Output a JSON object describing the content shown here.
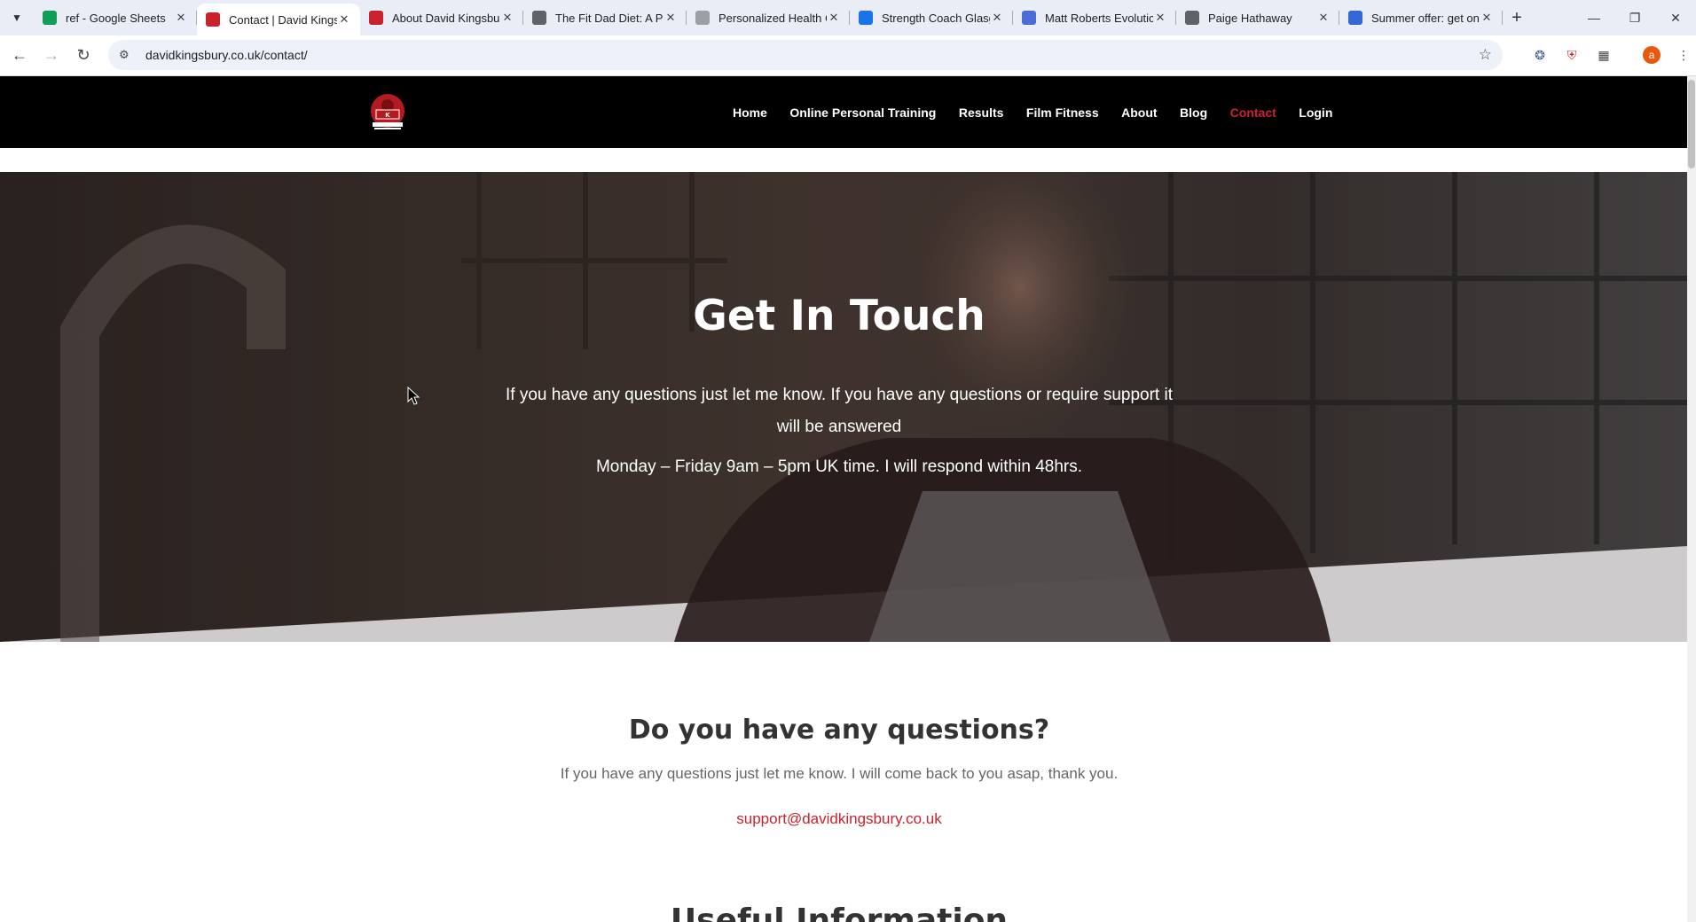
{
  "browser": {
    "tabs": [
      {
        "title": "ref - Google Sheets",
        "icon": "sheets-icon",
        "color": "#0f9d58",
        "active": false
      },
      {
        "title": "Contact | David Kings",
        "icon": "kingsbury-icon",
        "color": "#c8232c",
        "active": true
      },
      {
        "title": "About David Kingsbu",
        "icon": "kingsbury-icon",
        "color": "#c8232c",
        "active": false
      },
      {
        "title": "The Fit Dad Diet: A Pr",
        "icon": "globe-icon",
        "color": "#5f6368",
        "active": false
      },
      {
        "title": "Personalized Health C",
        "icon": "globe-icon",
        "color": "#9aa0a6",
        "active": false
      },
      {
        "title": "Strength Coach Glasg",
        "icon": "s-logo-icon",
        "color": "#1a73e8",
        "active": false
      },
      {
        "title": "Matt Roberts Evolutic",
        "icon": "m-logo-icon",
        "color": "#4a6cd4",
        "active": false
      },
      {
        "title": "Paige Hathaway",
        "icon": "globe-icon",
        "color": "#5f6368",
        "active": false
      },
      {
        "title": "Summer offer: get on",
        "icon": "offer-icon",
        "color": "#3367d6",
        "active": false
      }
    ],
    "url": "davidkingsbury.co.uk/contact/",
    "profile_initial": "a"
  },
  "site": {
    "nav": [
      {
        "label": "Home",
        "current": false
      },
      {
        "label": "Online Personal Training",
        "current": false
      },
      {
        "label": "Results",
        "current": false
      },
      {
        "label": "Film Fitness",
        "current": false
      },
      {
        "label": "About",
        "current": false
      },
      {
        "label": "Blog",
        "current": false
      },
      {
        "label": "Contact",
        "current": true
      },
      {
        "label": "Login",
        "current": false
      }
    ],
    "accent_color": "#c8232c"
  },
  "hero": {
    "title": "Get In Touch",
    "text": "If you have any questions just let me know. If you have any questions or require support it will be answered",
    "hours": "Monday – Friday 9am – 5pm UK time. I will respond within 48hrs."
  },
  "questions": {
    "title": "Do you have any questions?",
    "text": "If you have any questions just let me know. I will come back to you asap, thank you.",
    "email": "support@davidkingsbury.co.uk"
  },
  "useful": {
    "title": "Useful Information"
  }
}
